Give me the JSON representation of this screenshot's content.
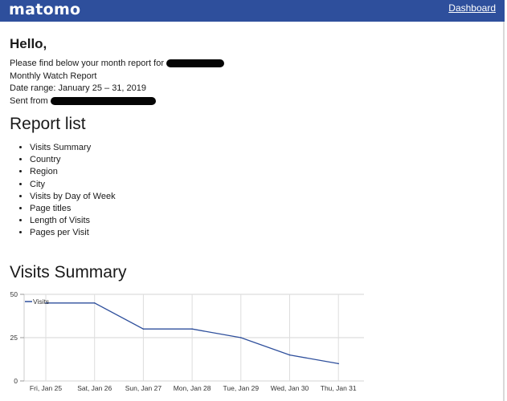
{
  "header": {
    "logo": "matomo",
    "dashboard_link": "Dashboard",
    "bg_color": "#2e4f9c"
  },
  "email": {
    "greeting": "Hello,",
    "line1": "Please find below your month report for",
    "line2": "Monthly Watch Report",
    "line3": "Date range: January 25 – 31, 2019",
    "line4": "Sent from"
  },
  "report_list": {
    "title": "Report list",
    "items": [
      "Visits Summary",
      "Country",
      "Region",
      "City",
      "Visits by Day of Week",
      "Page titles",
      "Length of Visits",
      "Pages per Visit"
    ]
  },
  "visits_summary": {
    "title": "Visits Summary"
  },
  "chart_data": {
    "type": "line",
    "categories": [
      "Fri, Jan 25",
      "Sat, Jan 26",
      "Sun, Jan 27",
      "Mon, Jan 28",
      "Tue, Jan 29",
      "Wed, Jan 30",
      "Thu, Jan 31"
    ],
    "series": [
      {
        "name": "Visits",
        "values": [
          45,
          45,
          30,
          30,
          25,
          15,
          10
        ],
        "color": "#2e4f9c"
      }
    ],
    "yticks": [
      0,
      25,
      50
    ],
    "ylim": [
      0,
      50
    ],
    "grid": true,
    "legend": "top-left"
  }
}
